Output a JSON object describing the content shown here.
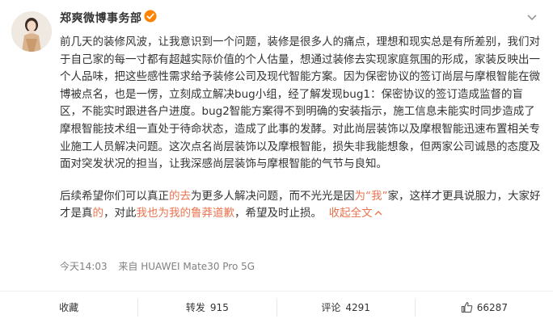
{
  "author": {
    "name": "郑爽微博事务部",
    "verified": true,
    "badge_color": "#ff8200"
  },
  "post": {
    "para1": "前几天的装修风波，让我意识到一个问题，装修是很多人的痛点，理想和现实总是有所差别，我们对于自己家的每一寸都有超越实际价值的个人估量，想通过装修去实现家庭氛围的形成，家装反映出一个人品味，把这些感性需求给予装修公司及现代智能方案。因为保密协议的签订尚层与摩根智能在微博被点名，也是一愣，立刻成立解决bug小组，经了解发现bug1：保密协议的签订造成监督的盲区，不能实时跟进各户进度。bug2智能方案得不到明确的安装指示，施工信息未能实时同步造成了摩根智能技术组一直处于待命状态，造成了此事的发酵。对此尚层装饰以及摩根智能迅速布置相关专业施工人员解决问题。这次点名尚层装饰以及摩根智能，损失非我能想象，但两家公司诚恳的态度及面对突发状况的担当，让我深感尚层装饰与摩根智能的气节与良知。",
    "para2_segments": [
      {
        "text": "后续希望你们可以真正",
        "highlight": false
      },
      {
        "text": "的去",
        "highlight": true
      },
      {
        "text": "为更多人解决问题，而不光光是因",
        "highlight": false
      },
      {
        "text": "为",
        "highlight": true
      },
      {
        "text": "“我”",
        "highlight": true
      },
      {
        "text": "家，这样才更具说服力，大家好才是真",
        "highlight": false
      },
      {
        "text": "的",
        "highlight": true
      },
      {
        "text": "，对此",
        "highlight": false
      },
      {
        "text": "我也为我的鲁莽道歉",
        "highlight": true
      },
      {
        "text": "，希望及时止损。",
        "highlight": false
      }
    ],
    "collapse_label": "收起全文"
  },
  "meta": {
    "time": "今天14:03",
    "source": "来自 HUAWEI Mate30 Pro 5G"
  },
  "actions": {
    "favorite": "收藏",
    "repost_label": "转发",
    "repost_count": "915",
    "comment_label": "评论",
    "comment_count": "4291",
    "like_count": "66287"
  },
  "colors": {
    "highlight": "#eb7350",
    "text": "#333333",
    "meta": "#808080"
  }
}
